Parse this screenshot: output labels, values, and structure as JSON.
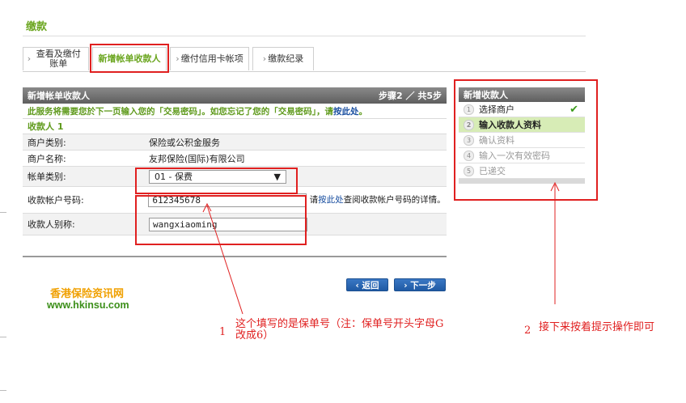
{
  "page": {
    "title": "缴款"
  },
  "tabs": [
    {
      "label": "查看及缴付账单",
      "arrow": "›"
    },
    {
      "label": "新增帐单收款人",
      "arrow": ""
    },
    {
      "label": "缴付信用卡帐项",
      "arrow": "›"
    },
    {
      "label": "缴款纪录",
      "arrow": "›"
    }
  ],
  "panel": {
    "title": "新增帐单收款人",
    "step": "步骤2 ／ 共5步",
    "notice_pre": "此服务将需要您於下一页输入您的「交易密码」。如您忘记了您的「交易密码」，请",
    "notice_link": "按此处",
    "notice_post": "。",
    "section": "收款人 1",
    "rows": {
      "merchant_type": {
        "label": "商户类别:",
        "value": "保险或公积金服务"
      },
      "merchant_name": {
        "label": "商户名称:",
        "value": "友邦保险(国际)有限公司"
      },
      "account_type": {
        "label": "帐单类别:",
        "value": "01 - 保费"
      },
      "account_number": {
        "label": "收款帐户号码:",
        "value": "612345678",
        "hint_pre": "请",
        "hint_link": "按此处",
        "hint_post": "查阅收款帐户号码的详情。"
      },
      "alias": {
        "label": "收款人别称:",
        "value": "wangxiaoming"
      }
    },
    "buttons": {
      "back": "‹ 返回",
      "next": "› 下一步"
    }
  },
  "watermark": {
    "line1": "香港保险资讯网",
    "line2": "www.hkinsu.com"
  },
  "steps_panel": {
    "title": "新增收款人",
    "steps": [
      {
        "num": "1",
        "label": "选择商户",
        "state": "done"
      },
      {
        "num": "2",
        "label": "输入收款人资料",
        "state": "current"
      },
      {
        "num": "3",
        "label": "确认资料",
        "state": "todo"
      },
      {
        "num": "4",
        "label": "输入一次有效密码",
        "state": "todo"
      },
      {
        "num": "5",
        "label": "已递交",
        "state": "todo"
      }
    ],
    "check": "✔"
  },
  "annotations": {
    "a1_num": "1",
    "a1_text": "这个填写的是保单号（注：保单号开头字母G改成6）",
    "a2_num": "2",
    "a2_text": "接下来按着提示操作即可"
  },
  "colors": {
    "accent_green": "#6aa51e",
    "annotation_red": "#e02020",
    "button_blue": "#2a67b4"
  }
}
